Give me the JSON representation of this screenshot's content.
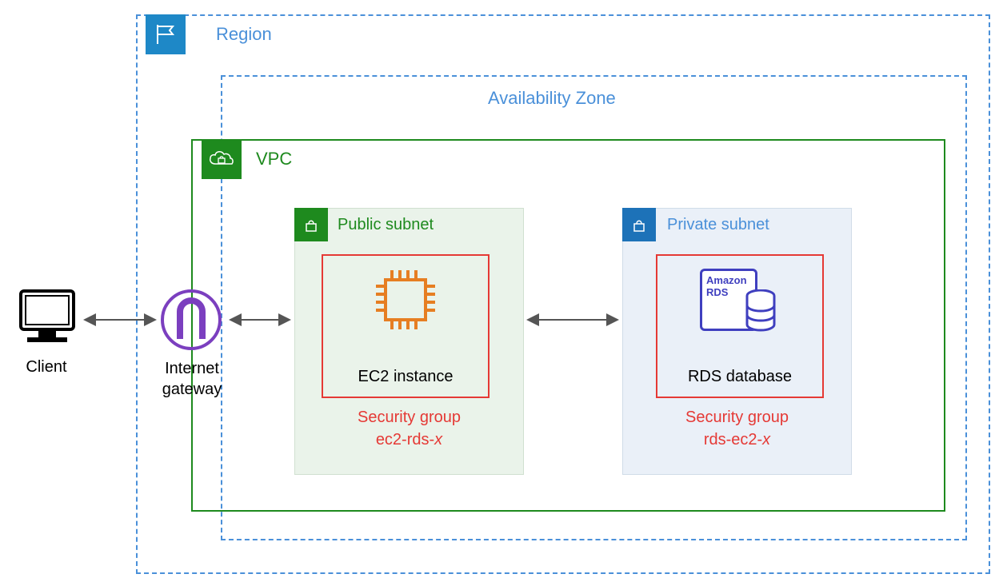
{
  "region": {
    "label": "Region"
  },
  "az": {
    "label": "Availability Zone"
  },
  "vpc": {
    "label": "VPC"
  },
  "public_subnet": {
    "label": "Public subnet"
  },
  "private_subnet": {
    "label": "Private subnet"
  },
  "ec2": {
    "label": "EC2 instance"
  },
  "rds": {
    "label": "RDS database",
    "brand_top": "Amazon",
    "brand_bottom": "RDS"
  },
  "sg_ec2": {
    "label": "Security group",
    "name_prefix": "ec2-rds-",
    "name_suffix": "x"
  },
  "sg_rds": {
    "label": "Security group",
    "name_prefix": "rds-ec2-",
    "name_suffix": "x"
  },
  "client": {
    "label": "Client"
  },
  "igw": {
    "label_line1": "Internet",
    "label_line2": "gateway"
  }
}
